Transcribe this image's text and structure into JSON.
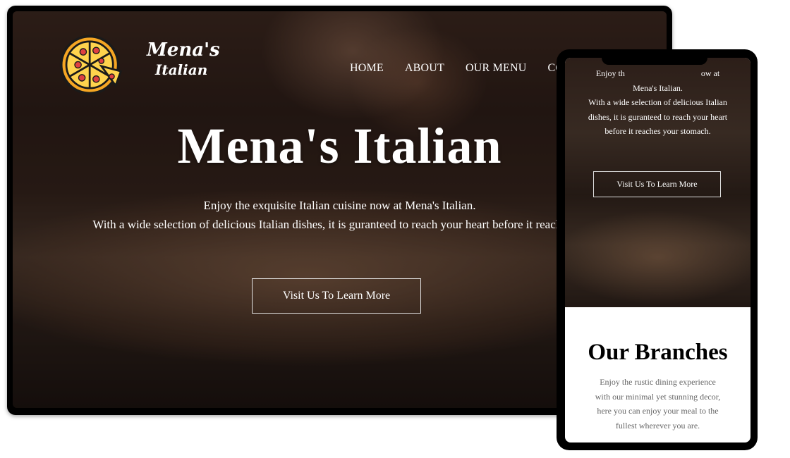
{
  "desktop": {
    "logo": {
      "line1": "Mena's",
      "line2": "Italian",
      "icon": "pizza-icon",
      "colors": {
        "crust": "#f5a623",
        "cheese": "#ffd34d",
        "pepperoni": "#e04040",
        "outline": "#1a1a1a"
      }
    },
    "nav": {
      "items": [
        {
          "label": "HOME"
        },
        {
          "label": "ABOUT"
        },
        {
          "label": "OUR MENU"
        },
        {
          "label": "CO"
        }
      ]
    },
    "hero": {
      "title": "Mena's Italian",
      "line1": "Enjoy the exquisite Italian cuisine now at Mena's Italian.",
      "line2": "With a wide selection of delicious Italian dishes, it is guranteed to reach your heart before it reaches yo",
      "cta": "Visit Us To Learn More"
    }
  },
  "mobile": {
    "hero": {
      "lines": [
        "Enjoy th                                    ow at",
        "Mena's Italian.",
        "With a wide selection of delicious Italian",
        "dishes, it is guranteed to reach your heart",
        "before it reaches your stomach."
      ],
      "cta": "Visit Us To Learn More"
    },
    "branches": {
      "title": "Our Branches",
      "lines": [
        "Enjoy the rustic dining experience",
        "with our minimal yet stunning decor,",
        "here you can enjoy your meal to the",
        "fullest wherever you are."
      ]
    }
  }
}
